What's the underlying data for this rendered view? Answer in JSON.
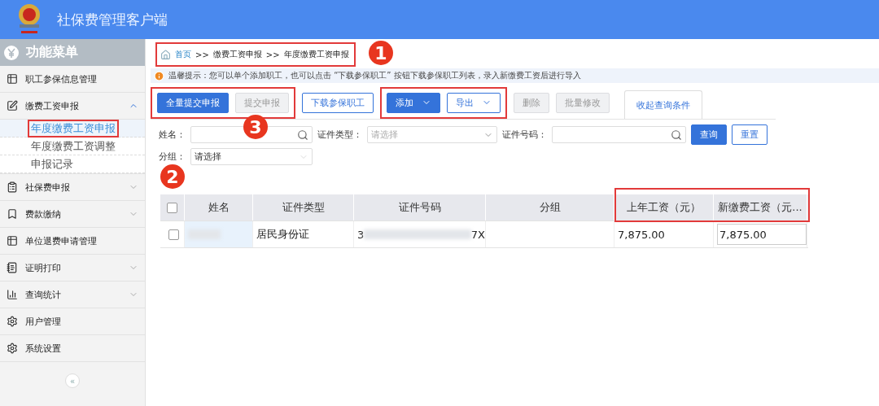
{
  "app": {
    "title": "社保费管理客户端"
  },
  "sidebar": {
    "title": "功能菜单",
    "items": [
      {
        "label": "职工参保信息管理",
        "kind": "table"
      },
      {
        "label": "缴费工资申报",
        "kind": "edit",
        "expanded": true,
        "children": [
          {
            "label": "年度缴费工资申报",
            "selected": true
          },
          {
            "label": "年度缴费工资调整",
            "selected": false
          },
          {
            "label": "申报记录",
            "selected": false
          }
        ]
      },
      {
        "label": "社保费申报",
        "kind": "list",
        "expanded": false
      },
      {
        "label": "费款缴纳",
        "kind": "bookmark",
        "expanded": false
      },
      {
        "label": "单位退费申请管理",
        "kind": "table"
      },
      {
        "label": "证明打印",
        "kind": "doc",
        "expanded": false
      },
      {
        "label": "查询统计",
        "kind": "chart",
        "expanded": false
      },
      {
        "label": "用户管理",
        "kind": "gear"
      },
      {
        "label": "系统设置",
        "kind": "gear"
      }
    ],
    "collapse": "«"
  },
  "breadcrumb": {
    "items": [
      "首页",
      "缴费工资申报",
      "年度缴费工资申报"
    ],
    "separator": ">>"
  },
  "tip": "温馨提示：您可以单个添加职工，也可以点击 “下载参保职工” 按钮下载参保职工列表，录入新缴费工资后进行导入",
  "toolbar": [
    {
      "label": "全量提交申报",
      "kind": "primary",
      "disabled": false
    },
    {
      "label": "提交申报",
      "kind": "default",
      "disabled": true
    },
    {
      "label": "下载参保职工",
      "kind": "outline",
      "disabled": false
    },
    {
      "label": "添加",
      "kind": "primary-dropdown",
      "disabled": false
    },
    {
      "label": "导出",
      "kind": "outline-dropdown",
      "disabled": false
    },
    {
      "label": "删除",
      "kind": "default",
      "disabled": true
    },
    {
      "label": "批量修改",
      "kind": "default",
      "disabled": true
    }
  ],
  "tab": "收起查询条件",
  "filters": {
    "name_label": "姓名：",
    "cert_type_label": "证件类型：",
    "cert_type_placeholder": "请选择",
    "cert_no_label": "证件号码：",
    "group_label": "分组：",
    "group_value": "请选择",
    "query": "查询",
    "reset": "重置"
  },
  "table": {
    "select_all_checked": false,
    "columns": [
      "姓名",
      "证件类型",
      "证件号码",
      "分组",
      "上年工资（元）",
      "新缴费工资（元..."
    ],
    "rows": [
      {
        "checked": false,
        "cert_type": "居民身份证",
        "cert_no_start": "3",
        "cert_no_end": "7X",
        "last_wage": "7,875.00",
        "new_wage": "7,875.00"
      }
    ]
  },
  "annotations": [
    "1",
    "2",
    "3"
  ]
}
